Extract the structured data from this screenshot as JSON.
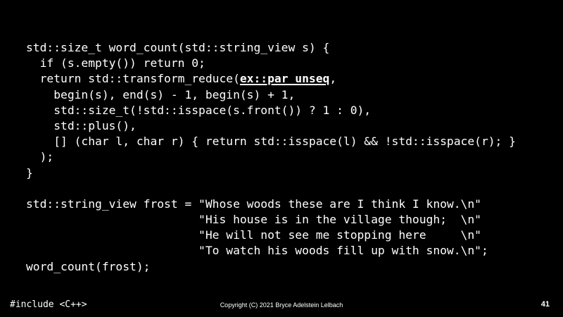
{
  "slide": {
    "code_lines": [
      "std::size_t word_count(std::string_view s) {",
      "  if (s.empty()) return 0;",
      {
        "pre": "  return std::transform_reduce(",
        "hl": "ex::par_unseq",
        "post": ","
      },
      "    begin(s), end(s) - 1, begin(s) + 1,",
      "    std::size_t(!std::isspace(s.front()) ? 1 : 0),",
      "    std::plus(),",
      "    [] (char l, char r) { return std::isspace(l) && !std::isspace(r); }",
      "  );",
      "}",
      "",
      "std::string_view frost = \"Whose woods these are I think I know.\\n\"",
      "                         \"His house is in the village though;  \\n\"",
      "                         \"He will not see me stopping here     \\n\"",
      "                         \"To watch his woods fill up with snow.\\n\";",
      "word_count(frost);"
    ]
  },
  "footer": {
    "left": "#include <C++>",
    "center": "Copyright (C) 2021 Bryce Adelstein Lelbach",
    "page_number": "41"
  }
}
